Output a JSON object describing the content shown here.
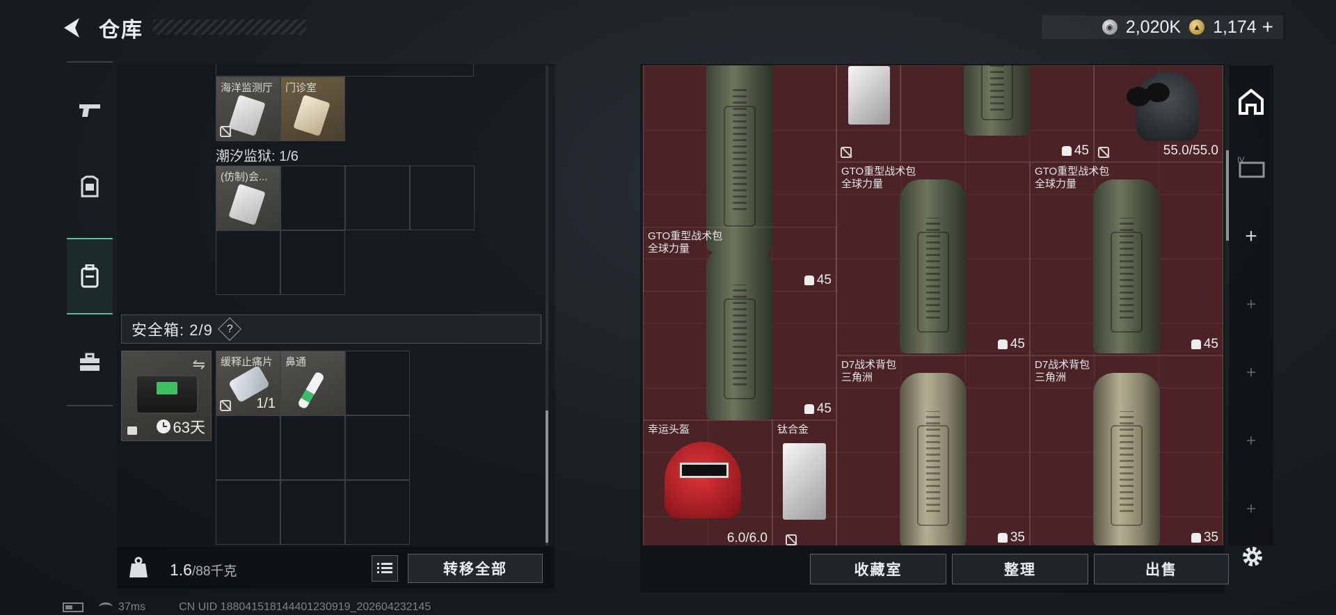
{
  "header": {
    "title": "仓库",
    "currencies": [
      {
        "icon": "silver-coin-icon",
        "value": "2,020K"
      },
      {
        "icon": "gold-coin-icon",
        "value": "1,174",
        "suffix": "+"
      }
    ]
  },
  "left_rail": {
    "items": [
      {
        "name": "weapons",
        "icon": "pistol-icon"
      },
      {
        "name": "armor",
        "icon": "armor-vest-icon"
      },
      {
        "name": "backpack",
        "icon": "backpack-icon",
        "active": true
      },
      {
        "name": "toolbox",
        "icon": "toolbox-icon"
      }
    ]
  },
  "map_items": [
    {
      "label": "海洋监测厅"
    },
    {
      "label": "门诊室"
    }
  ],
  "prison": {
    "label": "潮汐监狱: 1/6",
    "items": [
      {
        "label": "(仿制)会..."
      }
    ]
  },
  "safebox": {
    "label": "安全箱: 2/9",
    "help": "?",
    "days": "63天",
    "items": [
      {
        "label": "缓释止痛片",
        "count": "1/1"
      },
      {
        "label": "鼻通"
      }
    ]
  },
  "weight": {
    "value": "1.6",
    "unit": "/88千克"
  },
  "transfer_all": "转移全部",
  "stash": {
    "items": [
      {
        "name": "",
        "sub": "",
        "count": "45",
        "kind": "backpack-green"
      },
      {
        "name": "",
        "sub": "",
        "count": "",
        "kind": "titanium"
      },
      {
        "name": "",
        "sub": "",
        "count": "45",
        "kind": "backpack-green"
      },
      {
        "name": "",
        "sub": "",
        "durability": "55.0/55.0",
        "kind": "helmet-nvg"
      },
      {
        "name": "GTO重型战术包",
        "sub": "全球力量",
        "count": "45",
        "kind": "backpack-green"
      },
      {
        "name": "GTO重型战术包",
        "sub": "全球力量",
        "count": "45",
        "kind": "backpack-green"
      },
      {
        "name": "GTO重型战术包",
        "sub": "全球力量",
        "count": "45",
        "kind": "backpack-green"
      },
      {
        "name": "D7战术背包",
        "sub": "三角洲",
        "count": "35",
        "kind": "backpack-tan"
      },
      {
        "name": "D7战术背包",
        "sub": "三角洲",
        "count": "35",
        "kind": "backpack-tan"
      },
      {
        "name": "幸运头盔",
        "sub": "",
        "durability": "6.0/6.0",
        "kind": "helmet-red"
      },
      {
        "name": "钛合金",
        "sub": "",
        "kind": "titanium"
      }
    ]
  },
  "bottom_buttons": {
    "collection": "收藏室",
    "sort": "整理",
    "sell": "出售"
  },
  "right_rail": {
    "tabs": [
      {
        "icon": "stash-home-icon",
        "active": true
      },
      {
        "icon": "stash-tier4-icon",
        "label": "IV"
      },
      {
        "icon": "add-icon",
        "label": "+"
      },
      {
        "icon": "add-icon-dim",
        "label": "+"
      },
      {
        "icon": "add-icon-dim",
        "label": "+"
      },
      {
        "icon": "add-icon-dim",
        "label": "+"
      },
      {
        "icon": "add-icon-dim",
        "label": "+"
      }
    ]
  },
  "status": {
    "ping": "37ms",
    "uid": "CN UID 1880415181444012309​19_202604232145"
  },
  "colors": {
    "accent_green": "#55c39a",
    "stash_bg": "#4b2225"
  }
}
